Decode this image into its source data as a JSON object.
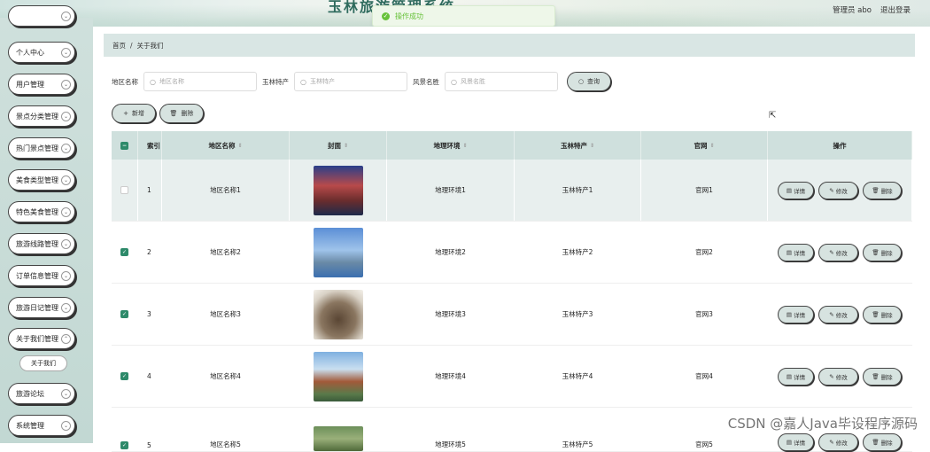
{
  "header": {
    "site_title": "玉林旅游管理系统",
    "user_label": "管理员 abo",
    "logout_label": "退出登录"
  },
  "toast": {
    "message": "操作成功"
  },
  "sidebar": {
    "items": [
      {
        "label": "个人中心"
      },
      {
        "label": "用户管理"
      },
      {
        "label": "景点分类管理"
      },
      {
        "label": "热门景点管理"
      },
      {
        "label": "美食类型管理"
      },
      {
        "label": "特色美食管理"
      },
      {
        "label": "旅游线路管理"
      },
      {
        "label": "订单信息管理"
      },
      {
        "label": "旅游日记管理"
      },
      {
        "label": "关于我们管理"
      },
      {
        "label": "旅游论坛"
      },
      {
        "label": "系统管理"
      }
    ],
    "submenu": {
      "label": "关于我们"
    }
  },
  "breadcrumb": {
    "home": "首页",
    "sep": "/",
    "current": "关于我们"
  },
  "search": {
    "region_label": "地区名称",
    "region_placeholder": "地区名称",
    "spec_label": "玉林特产",
    "spec_placeholder": "玉林特产",
    "scenic_label": "风景名胜",
    "scenic_placeholder": "风景名胜",
    "query_label": "查询"
  },
  "actions": {
    "add_label": "新增",
    "delete_label": "删除"
  },
  "table": {
    "headers": {
      "index": "索引",
      "name": "地区名称",
      "cover": "封面",
      "env": "地理环境",
      "spec": "玉林特产",
      "site": "官网",
      "ops": "操作"
    },
    "rows": [
      {
        "checked": false,
        "index": "1",
        "name": "地区名称1",
        "env": "地理环境1",
        "spec": "玉林特产1",
        "site": "官网1"
      },
      {
        "checked": true,
        "index": "2",
        "name": "地区名称2",
        "env": "地理环境2",
        "spec": "玉林特产2",
        "site": "官网2"
      },
      {
        "checked": true,
        "index": "3",
        "name": "地区名称3",
        "env": "地理环境3",
        "spec": "玉林特产3",
        "site": "官网3"
      },
      {
        "checked": true,
        "index": "4",
        "name": "地区名称4",
        "env": "地理环境4",
        "spec": "玉林特产4",
        "site": "官网4"
      },
      {
        "checked": true,
        "index": "5",
        "name": "地区名称5",
        "env": "地理环境5",
        "spec": "玉林特产5",
        "site": "官网5"
      }
    ],
    "row_actions": {
      "detail": "详情",
      "edit": "修改",
      "delete": "删除"
    }
  },
  "watermark": "CSDN @嘉人Java毕设程序源码",
  "colors": {
    "accent": "#2e8a6a",
    "sidebar_bg": "#c8dcd7",
    "header_row": "#cfe0dd",
    "success": "#67c23a"
  }
}
